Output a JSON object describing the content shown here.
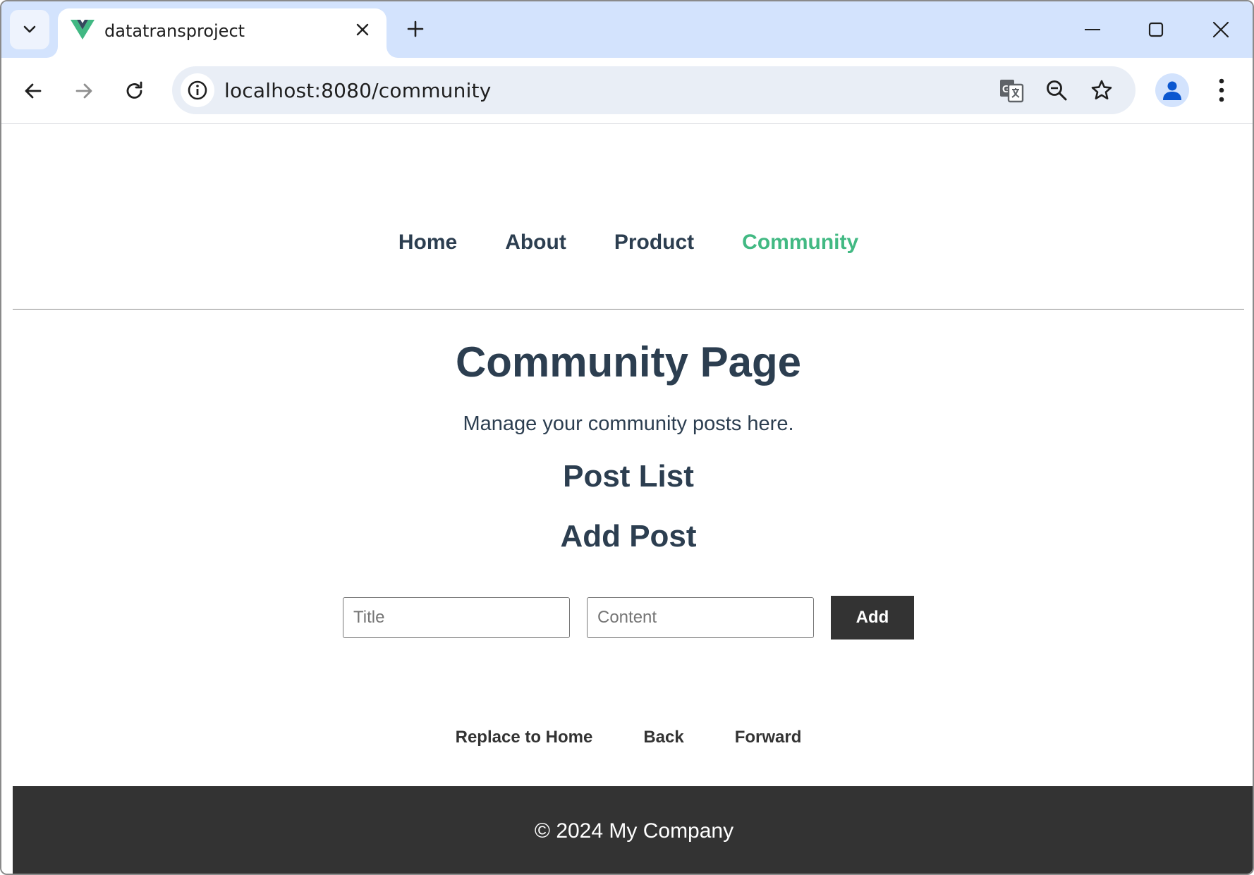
{
  "browser": {
    "tab_title": "datatransproject",
    "url": "localhost:8080/community"
  },
  "nav": {
    "items": [
      {
        "label": "Home"
      },
      {
        "label": "About"
      },
      {
        "label": "Product"
      },
      {
        "label": "Community"
      }
    ],
    "active": "Community",
    "active_color": "#42b983"
  },
  "page": {
    "title": "Community Page",
    "description": "Manage your community posts here.",
    "post_list_heading": "Post List",
    "add_post_heading": "Add Post"
  },
  "form": {
    "title_placeholder": "Title",
    "title_value": "",
    "content_placeholder": "Content",
    "content_value": "",
    "add_label": "Add"
  },
  "router_buttons": {
    "replace": "Replace to Home",
    "back": "Back",
    "forward": "Forward"
  },
  "footer": {
    "text": "© 2024 My Company"
  },
  "colors": {
    "text": "#2c3e50",
    "footer_bg": "#333333",
    "tabstrip_bg": "#d3e3fd"
  }
}
